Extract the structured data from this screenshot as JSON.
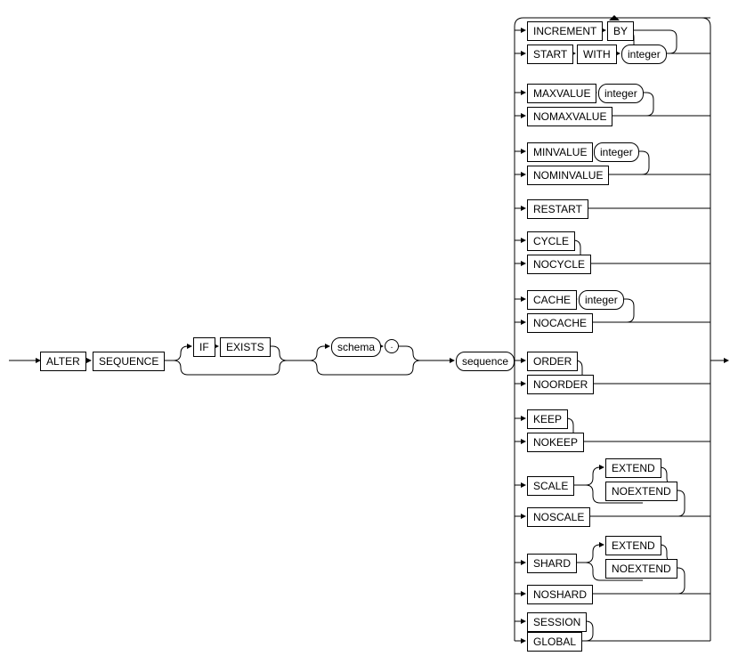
{
  "diagram": {
    "title": "ALTER SEQUENCE syntax railroad diagram",
    "keywords": {
      "alter": "ALTER",
      "sequence_kw": "SEQUENCE",
      "if": "IF",
      "exists": "EXISTS",
      "schema": "schema",
      "dot": ".",
      "sequence": "sequence",
      "increment": "INCREMENT",
      "by": "BY",
      "start": "START",
      "with": "WITH",
      "integer": "integer",
      "maxvalue": "MAXVALUE",
      "nomaxvalue": "NOMAXVALUE",
      "minvalue": "MINVALUE",
      "nominvalue": "NOMINVALUE",
      "restart": "RESTART",
      "cycle": "CYCLE",
      "nocycle": "NOCYCLE",
      "cache": "CACHE",
      "nocache": "NOCACHE",
      "order": "ORDER",
      "noorder": "NOORDER",
      "keep": "KEEP",
      "nokeep": "NOKEEP",
      "scale": "SCALE",
      "noscale": "NOSCALE",
      "shard": "SHARD",
      "noshard": "NOSHARD",
      "extend": "EXTEND",
      "noextend": "NOEXTEND",
      "session": "SESSION",
      "global": "GLOBAL"
    },
    "options_structure": [
      {
        "group": "increment_start",
        "members": [
          "INCREMENT BY",
          "START WITH integer"
        ]
      },
      {
        "group": "maxvalue",
        "members": [
          "MAXVALUE integer",
          "NOMAXVALUE"
        ]
      },
      {
        "group": "minvalue",
        "members": [
          "MINVALUE integer",
          "NOMINVALUE"
        ]
      },
      {
        "group": "restart",
        "members": [
          "RESTART"
        ]
      },
      {
        "group": "cycle",
        "members": [
          "CYCLE",
          "NOCYCLE"
        ]
      },
      {
        "group": "cache",
        "members": [
          "CACHE integer",
          "NOCACHE"
        ]
      },
      {
        "group": "order",
        "members": [
          "ORDER",
          "NOORDER"
        ]
      },
      {
        "group": "keep",
        "members": [
          "KEEP",
          "NOKEEP"
        ]
      },
      {
        "group": "scale",
        "members": [
          "SCALE [EXTEND|NOEXTEND]",
          "NOSCALE"
        ]
      },
      {
        "group": "shard",
        "members": [
          "SHARD [EXTEND|NOEXTEND]",
          "NOSHARD"
        ]
      },
      {
        "group": "scope",
        "members": [
          "SESSION",
          "GLOBAL"
        ]
      }
    ]
  }
}
